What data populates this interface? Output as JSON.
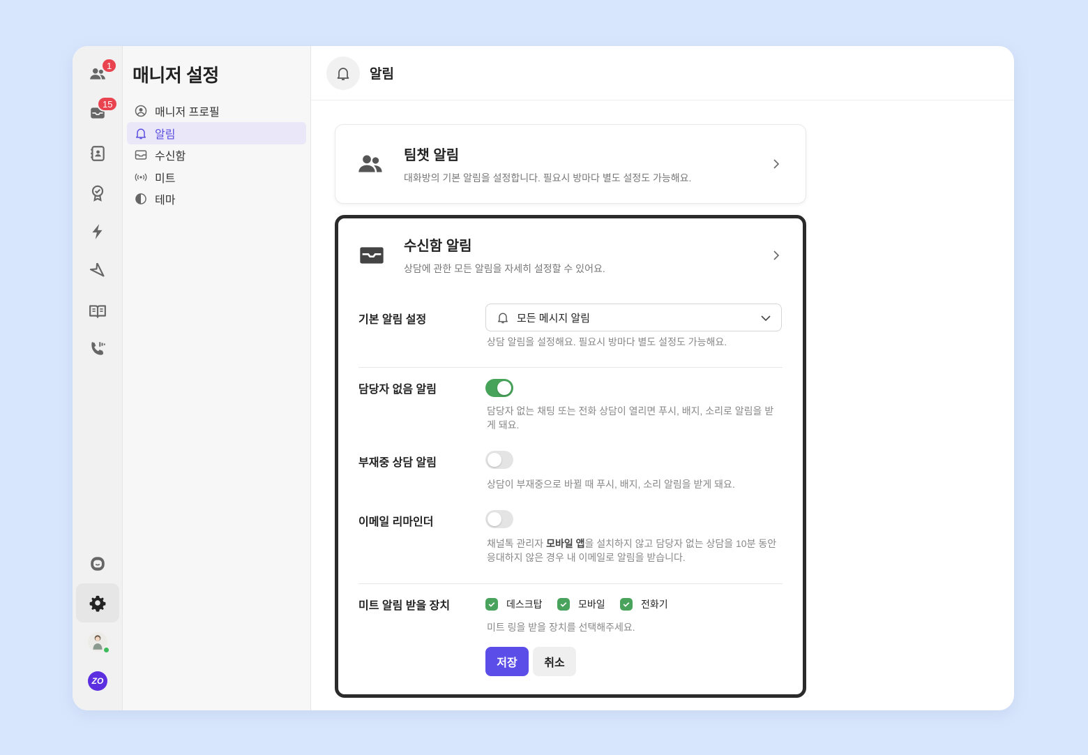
{
  "rail": {
    "badges": {
      "users": "1",
      "inbox": "15"
    }
  },
  "nav": {
    "title": "매니저 설정",
    "items": [
      {
        "label": "매니저 프로필",
        "icon": "profile-icon"
      },
      {
        "label": "알림",
        "icon": "bell-icon"
      },
      {
        "label": "수신함",
        "icon": "inbox-icon"
      },
      {
        "label": "미트",
        "icon": "broadcast-icon"
      },
      {
        "label": "테마",
        "icon": "theme-icon"
      }
    ]
  },
  "header": {
    "title": "알림"
  },
  "team_chat": {
    "title": "팀챗 알림",
    "desc": "대화방의 기본 알림을 설정합니다. 필요시 방마다 별도 설정도 가능해요."
  },
  "inbox": {
    "title": "수신함 알림",
    "desc": "상담에 관한 모든 알림을 자세히 설정할 수 있어요.",
    "default_label": "기본 알림 설정",
    "default_value": "모든 메시지 알림",
    "default_help": "상담 알림을 설정해요. 필요시 방마다 별도 설정도 가능해요.",
    "unassigned_label": "담당자 없음 알림",
    "unassigned_help": "담당자 없는 채팅 또는 전화 상담이 열리면 푸시, 배지, 소리로 알림을 받게 돼요.",
    "away_label": "부재중 상담 알림",
    "away_help": "상담이 부재중으로 바뀔 때 푸시, 배지, 소리 알림을 받게 돼요.",
    "email_label": "이메일 리마인더",
    "email_help_pre": "채널톡 관리자 ",
    "email_help_bold": "모바일 앱",
    "email_help_post": "을 설치하지 않고 담당자 없는 상담을 10분 동안 응대하지 않은 경우 내 이메일로 알림을 받습니다.",
    "meet_label": "미트 알림 받을 장치",
    "devices": [
      "데스크탑",
      "모바일",
      "전화기"
    ],
    "meet_help": "미트 링을 받을 장치를 선택해주세요.",
    "save": "저장",
    "cancel": "취소"
  },
  "colors": {
    "accent": "#5b4ee8",
    "toggle_on": "#47a25a",
    "badge": "#e8434f"
  }
}
